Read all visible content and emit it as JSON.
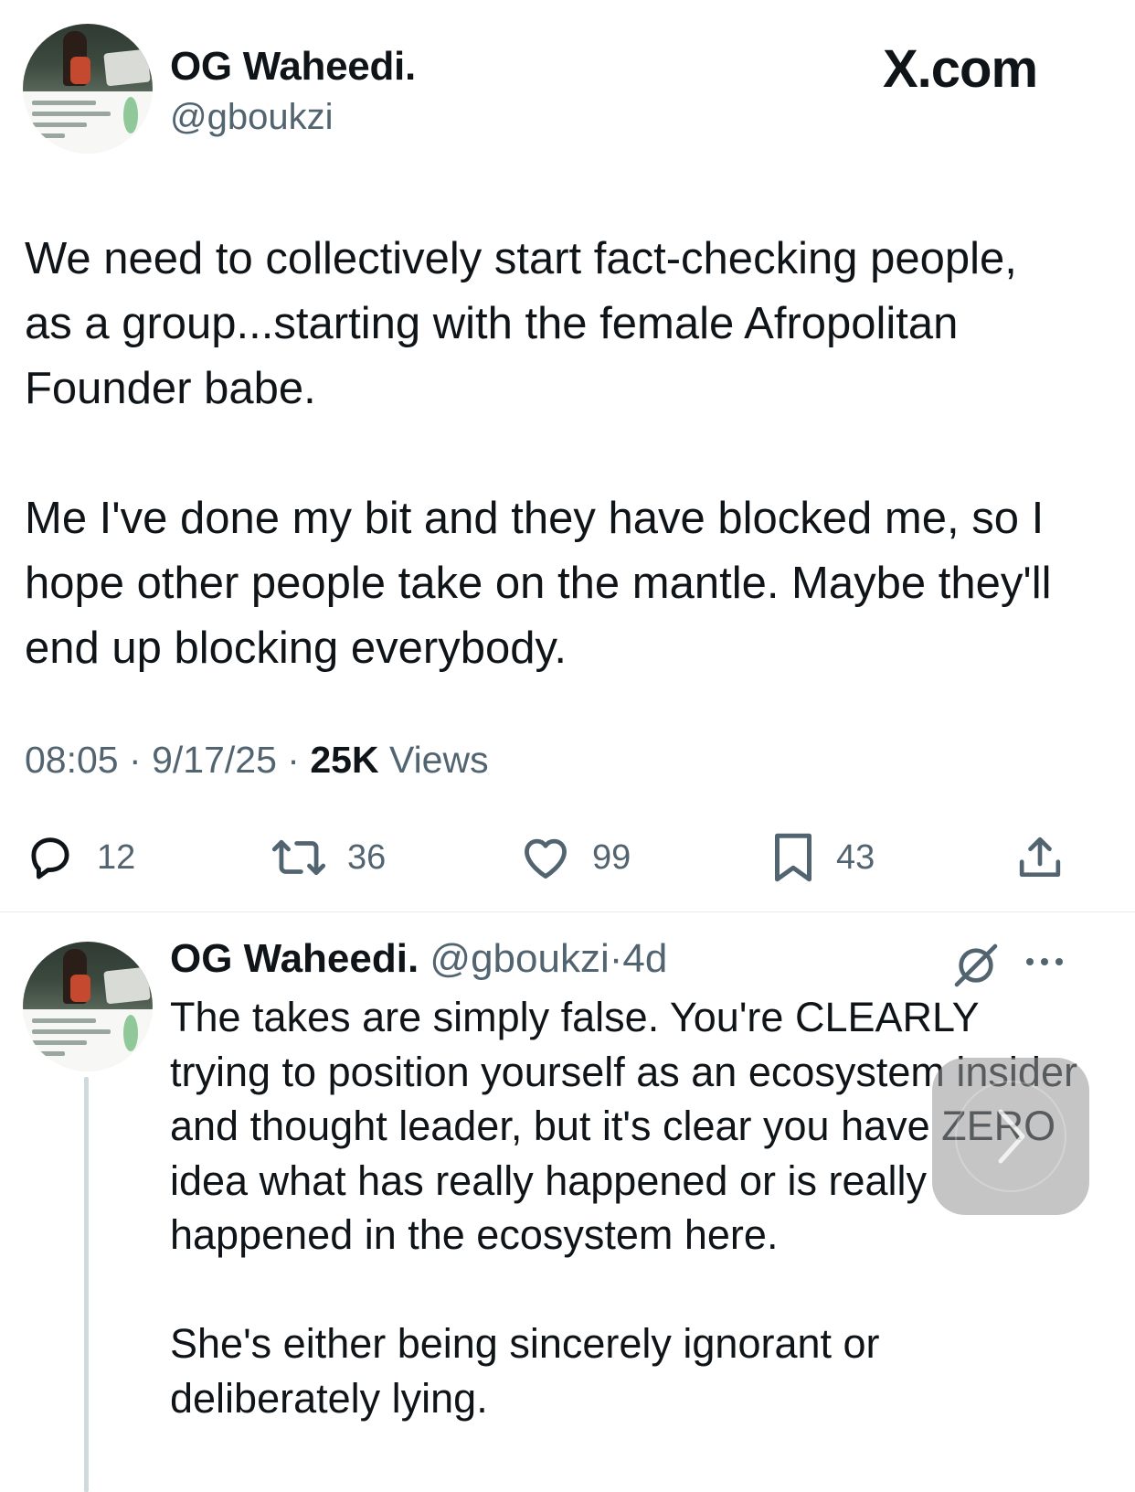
{
  "site_logo": "X.com",
  "tweet": {
    "author_name": "OG Waheedi.",
    "author_handle": "@gboukzi",
    "paragraphs": [
      "We need to collectively start fact-checking people, as a group...starting with the female Afropolitan Founder babe.",
      "Me I've done my bit and they have blocked me, so I hope other people take on the mantle. Maybe they'll end up blocking everybody."
    ],
    "time": "08:05",
    "date": "9/17/25",
    "separator": "·",
    "views_count": "25K",
    "views_label": "Views",
    "replies": "12",
    "reposts": "36",
    "likes": "99",
    "bookmarks": "43"
  },
  "reply": {
    "author_name": "OG Waheedi.",
    "author_handle": "@gboukzi",
    "age": "4d",
    "separator": "·",
    "paragraphs": [
      "The takes are simply false. You're CLEARLY trying to position yourself as an ecosystem insider and thought leader, but it's clear you have ZERO idea what has really happened or is really happened in the ecosystem here.",
      "She's either being sincerely ignorant or deliberately lying."
    ]
  },
  "icons": {
    "reply": "reply-bubble-icon",
    "repost": "repost-icon",
    "like": "heart-icon",
    "bookmark": "bookmark-icon",
    "share": "share-icon",
    "grok": "grok-icon",
    "more": "more-dots-icon",
    "next": "chevron-right-icon"
  },
  "colors": {
    "text_primary": "#0f1419",
    "text_secondary": "#536471",
    "divider": "#e6ecf0"
  }
}
